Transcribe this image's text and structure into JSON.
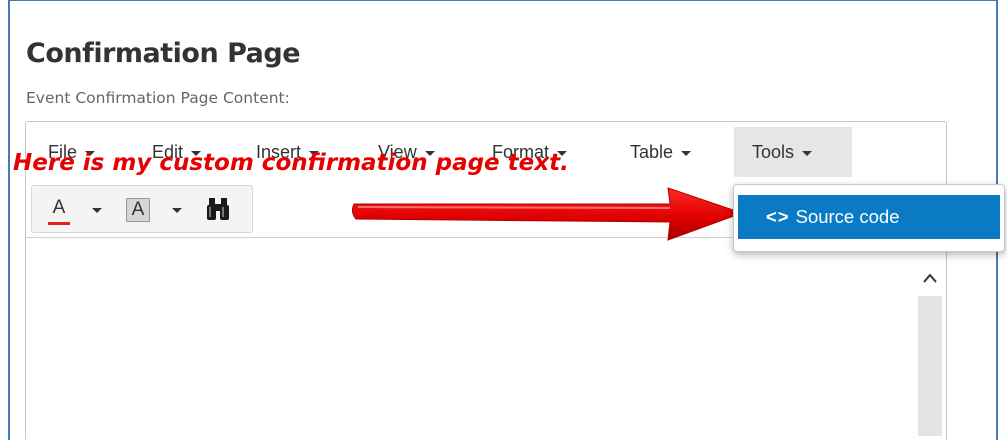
{
  "page": {
    "title": "Confirmation Page",
    "section_label": "Event Confirmation Page Content:"
  },
  "menubar": {
    "items": [
      {
        "label": "File"
      },
      {
        "label": "Edit"
      },
      {
        "label": "Insert"
      },
      {
        "label": "View"
      },
      {
        "label": "Format"
      },
      {
        "label": "Table"
      },
      {
        "label": "Tools",
        "active": true
      }
    ]
  },
  "toolbar": {
    "buttons": [
      {
        "glyph": "A",
        "icon": "text-color-icon",
        "color": "#e02020"
      },
      {
        "glyph": "A",
        "icon": "background-color-icon"
      },
      {
        "icon": "binoculars-icon"
      }
    ]
  },
  "content": {
    "text": "Here is my custom confirmation page text.",
    "text_color": "#e60000"
  },
  "dropdown": {
    "item_icon": "<>",
    "item_label": "Source code",
    "highlight_color": "#0a7ac4"
  },
  "annotation": {
    "arrow_color": "#e00000"
  }
}
